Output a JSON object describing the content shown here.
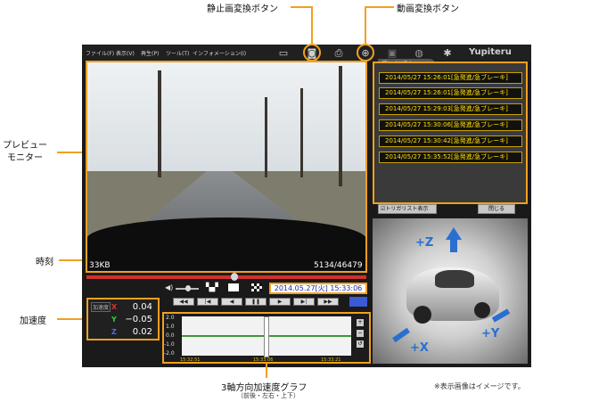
{
  "callouts": {
    "still_convert": "静止画変換ボタン",
    "video_convert": "動画変換ボタン",
    "preview": "プレビュー\nモニター",
    "time": "時刻",
    "accel": "加速度",
    "graph": "3軸方向加速度グラフ",
    "graph_sub": "（前後・左右・上下）",
    "note": "※表示画像はイメージです。"
  },
  "menu": [
    "ファイル(F)",
    "表示(V)",
    "再生(P)",
    "ツール(T)",
    "インフォメーション(I)"
  ],
  "brand": "Yupiteru",
  "toolbar_icons": [
    "folder-icon",
    "camera-icon",
    "printer-icon",
    "magnifier-icon",
    "save-icon",
    "globe-icon",
    "gear-icon"
  ],
  "preview": {
    "size": "33KB",
    "frame": "5134/46479"
  },
  "playlist": {
    "tab": "プレイリスト",
    "items": [
      "2014/05/27 15:26:01[急発進/急ブレーキ]",
      "2014/05/27 15:26:01[急発進/急ブレーキ]",
      "2014/05/27 15:29:03[急発進/急ブレーキ]",
      "2014/05/27 15:30:06[急発進/急ブレーキ]",
      "2014/05/27 15:30:42[急発進/急ブレーキ]",
      "2014/05/27 15:35:52[急発進/急ブレーキ]"
    ],
    "trigger_checkbox": "トリガリスト表示",
    "close": "閉じる"
  },
  "timestamp": "2014.05.27[火] 15:33:06",
  "seek_progress": 0.53,
  "accel": {
    "label": "加速度",
    "x_label": "X",
    "y_label": "Y",
    "z_label": "Z",
    "x": "0.04",
    "y": "−0.05",
    "z": "0.02"
  },
  "graph": {
    "y_ticks": [
      "2.0",
      "1.0",
      "0.0",
      "-1.0",
      "-2.0"
    ],
    "x_ticks": [
      "15:32:51",
      "15:33:06",
      "15:33:21"
    ]
  },
  "car_axes": {
    "z": "+Z",
    "x": "+X",
    "y": "+Y"
  },
  "colors": {
    "accent": "#f0a020",
    "list_text": "#ffe000",
    "axis_blue": "#2a6fd0"
  }
}
